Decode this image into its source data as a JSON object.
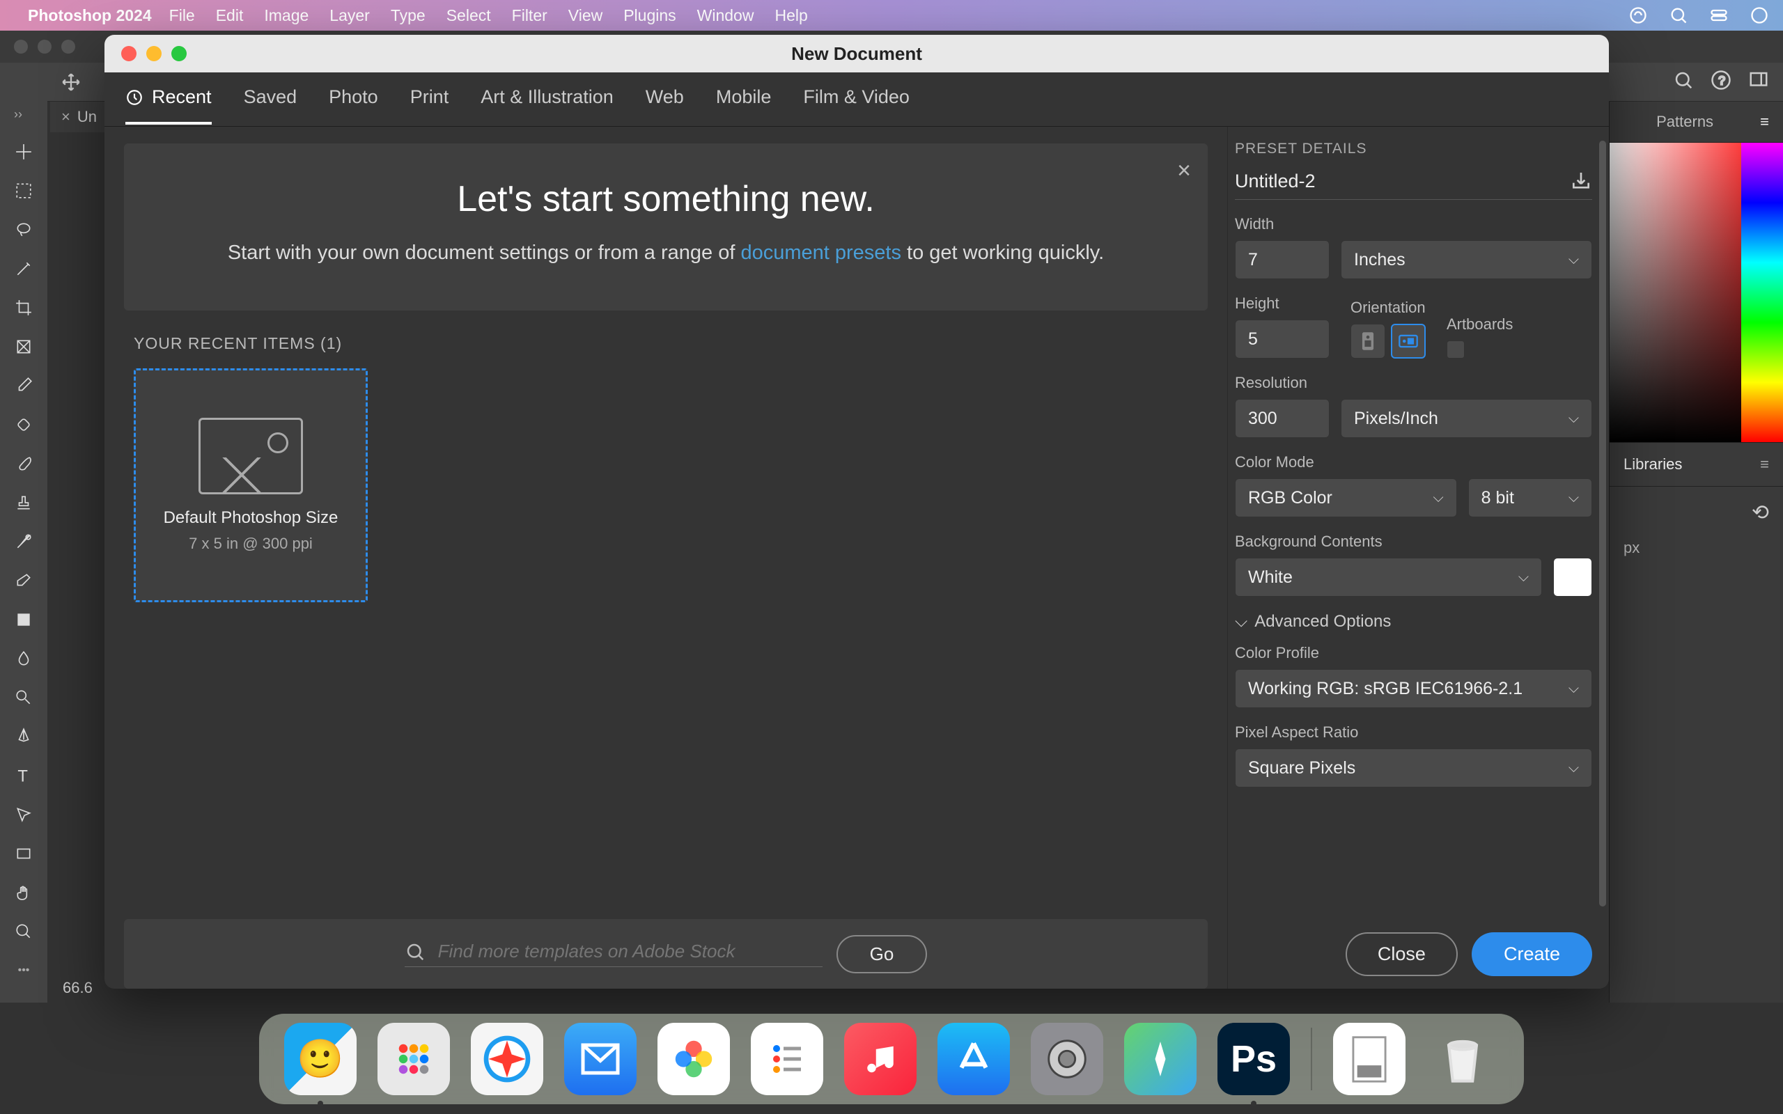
{
  "menubar": {
    "app": "Photoshop 2024",
    "items": [
      "File",
      "Edit",
      "Image",
      "Layer",
      "Type",
      "Select",
      "Filter",
      "View",
      "Plugins",
      "Window",
      "Help"
    ]
  },
  "modal": {
    "title": "New Document",
    "tabs": [
      "Recent",
      "Saved",
      "Photo",
      "Print",
      "Art & Illustration",
      "Web",
      "Mobile",
      "Film & Video"
    ],
    "hero_heading": "Let's start something new.",
    "hero_line_pre": "Start with your own document settings or from a range of ",
    "hero_link": "document presets",
    "hero_line_post": " to get working quickly.",
    "recent_label": "YOUR RECENT ITEMS  (1)",
    "recent_item": {
      "title": "Default Photoshop Size",
      "sub": "7 x 5 in @ 300 ppi"
    },
    "stock_placeholder": "Find more templates on Adobe Stock",
    "go": "Go",
    "close": "Close",
    "create": "Create"
  },
  "details": {
    "heading": "PRESET DETAILS",
    "name": "Untitled-2",
    "width_label": "Width",
    "width": "7",
    "width_unit": "Inches",
    "height_label": "Height",
    "height": "5",
    "orientation_label": "Orientation",
    "artboards_label": "Artboards",
    "resolution_label": "Resolution",
    "resolution": "300",
    "resolution_unit": "Pixels/Inch",
    "color_mode_label": "Color Mode",
    "color_mode": "RGB Color",
    "bit_depth": "8 bit",
    "bg_label": "Background Contents",
    "bg": "White",
    "adv": "Advanced Options",
    "profile_label": "Color Profile",
    "profile": "Working RGB: sRGB IEC61966-2.1",
    "par_label": "Pixel Aspect Ratio",
    "par": "Square Pixels"
  },
  "right_panel": {
    "tab_patterns": "Patterns",
    "tab_libraries": "Libraries",
    "px": "px"
  },
  "doc_tab": "Un",
  "zoom": "66.6"
}
